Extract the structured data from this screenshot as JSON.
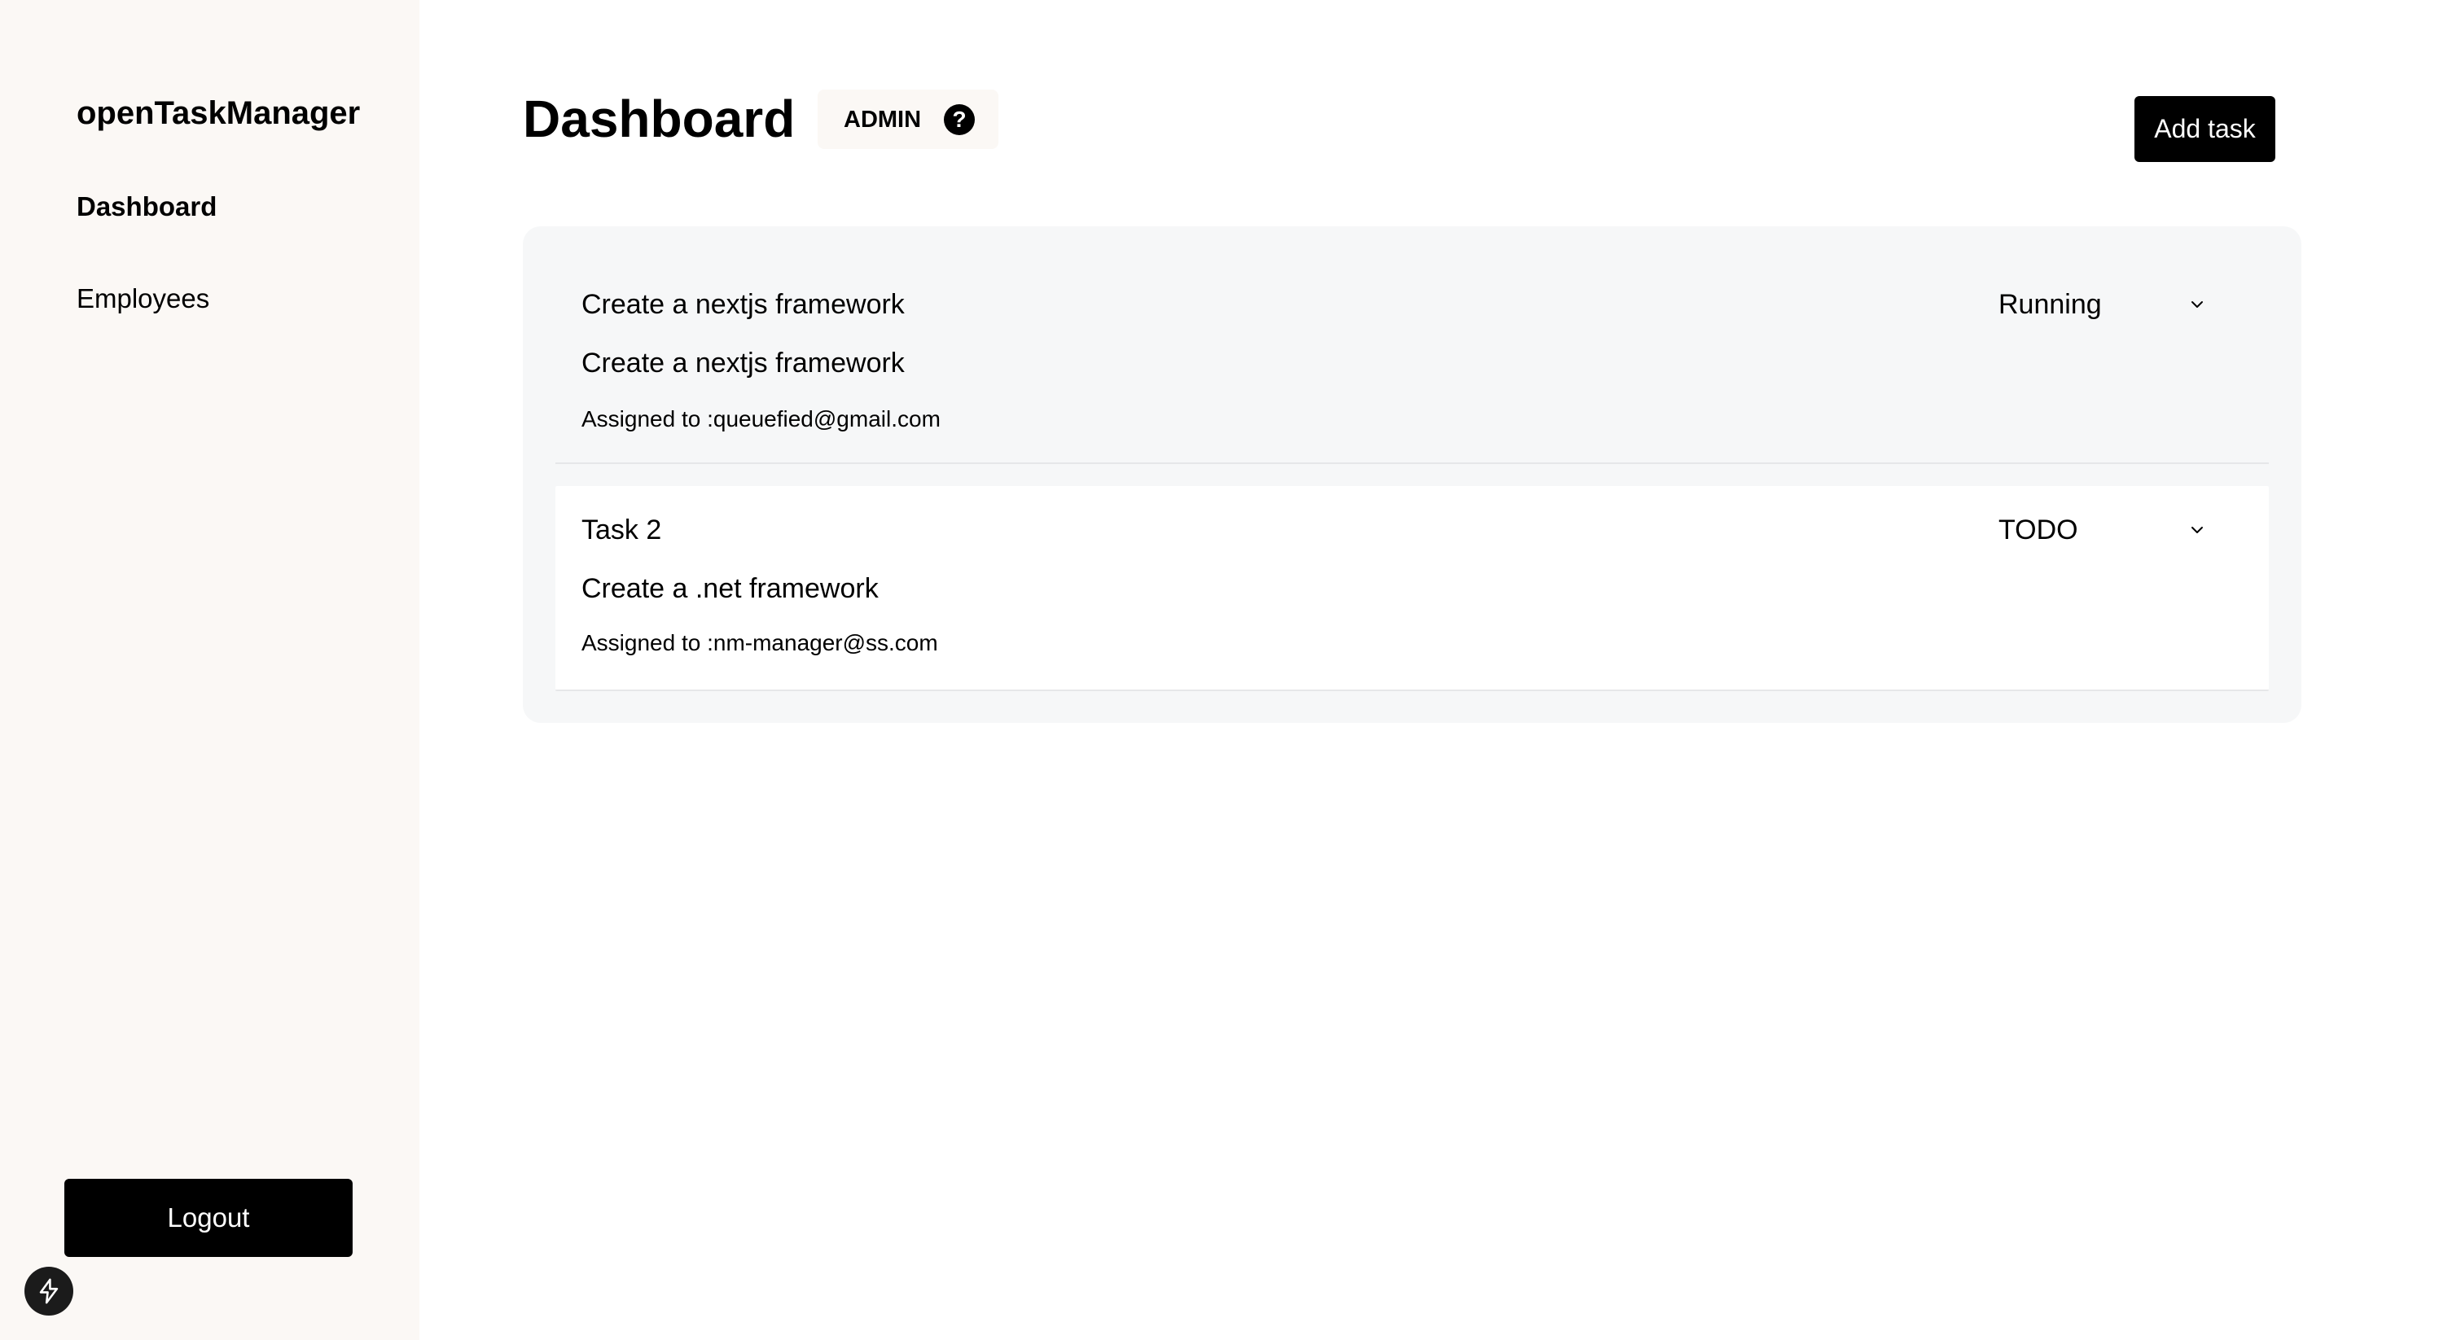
{
  "sidebar": {
    "brand": "openTaskManager",
    "items": [
      {
        "label": "Dashboard",
        "active": true
      },
      {
        "label": "Employees",
        "active": false
      }
    ],
    "logout_label": "Logout"
  },
  "header": {
    "title": "Dashboard",
    "role_badge": "ADMIN",
    "help_icon": "?",
    "add_task_label": "Add task"
  },
  "tasks": [
    {
      "title": "Create a nextjs framework",
      "description": "Create a nextjs framework",
      "assigned": "Assigned to :queuefied@gmail.com",
      "status": "Running"
    },
    {
      "title": "Task 2",
      "description": "Create a .net framework",
      "assigned": "Assigned to :nm-manager@ss.com",
      "status": "TODO"
    }
  ],
  "icons": {
    "help": "help-icon",
    "chevron": "chevron-down-icon",
    "bolt": "bolt-icon"
  },
  "colors": {
    "sidebar_bg": "#fbf8f5",
    "panel_bg": "#f6f7f8",
    "button_bg": "#000000",
    "button_text": "#ffffff"
  }
}
